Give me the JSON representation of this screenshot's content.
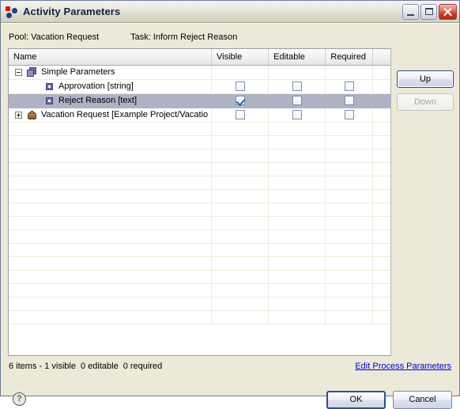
{
  "window": {
    "title": "Activity Parameters",
    "icon": "app-dots-icon",
    "controls": {
      "minimize": "minimize-icon",
      "maximize": "maximize-icon",
      "close": "close-icon"
    }
  },
  "context": {
    "pool": "Pool: Vacation Request",
    "task": "Task: Inform Reject Reason"
  },
  "table": {
    "columns": [
      "Name",
      "Visible",
      "Editable",
      "Required"
    ],
    "rows": [
      {
        "name": "Simple Parameters",
        "indent": 0,
        "twisty": "minus",
        "icon": "group-icon",
        "has_checkboxes": false,
        "visible": false,
        "editable": false,
        "required": false,
        "selected": false
      },
      {
        "name": "Approvation [string]",
        "indent": 1,
        "twisty": "none",
        "icon": "param-icon",
        "has_checkboxes": true,
        "visible": false,
        "editable": false,
        "required": false,
        "selected": false
      },
      {
        "name": "Reject Reason [text]",
        "indent": 1,
        "twisty": "none",
        "icon": "param-icon",
        "has_checkboxes": true,
        "visible": true,
        "editable": false,
        "required": false,
        "selected": true
      },
      {
        "name": "Vacation Request [Example Project/Vacatio",
        "indent": 0,
        "twisty": "plus",
        "icon": "pool-icon",
        "has_checkboxes": true,
        "visible": false,
        "editable": false,
        "required": false,
        "selected": false
      }
    ],
    "empty_rows": 15
  },
  "side_buttons": [
    {
      "label": "Up",
      "enabled": true
    },
    {
      "label": "Down",
      "enabled": false
    }
  ],
  "status": {
    "items": "6 items - 1 visible",
    "editable": "0 editable",
    "required": "0 required"
  },
  "link": {
    "label": "Edit Process Parameters"
  },
  "footer": {
    "help": "?",
    "ok": "OK",
    "cancel": "Cancel"
  },
  "colors": {
    "dialog_bg": "#ece9d8",
    "selection": "#adb3c4",
    "check": "#1d5fb2",
    "link": "#0000d0",
    "grid": "#eceadb"
  }
}
